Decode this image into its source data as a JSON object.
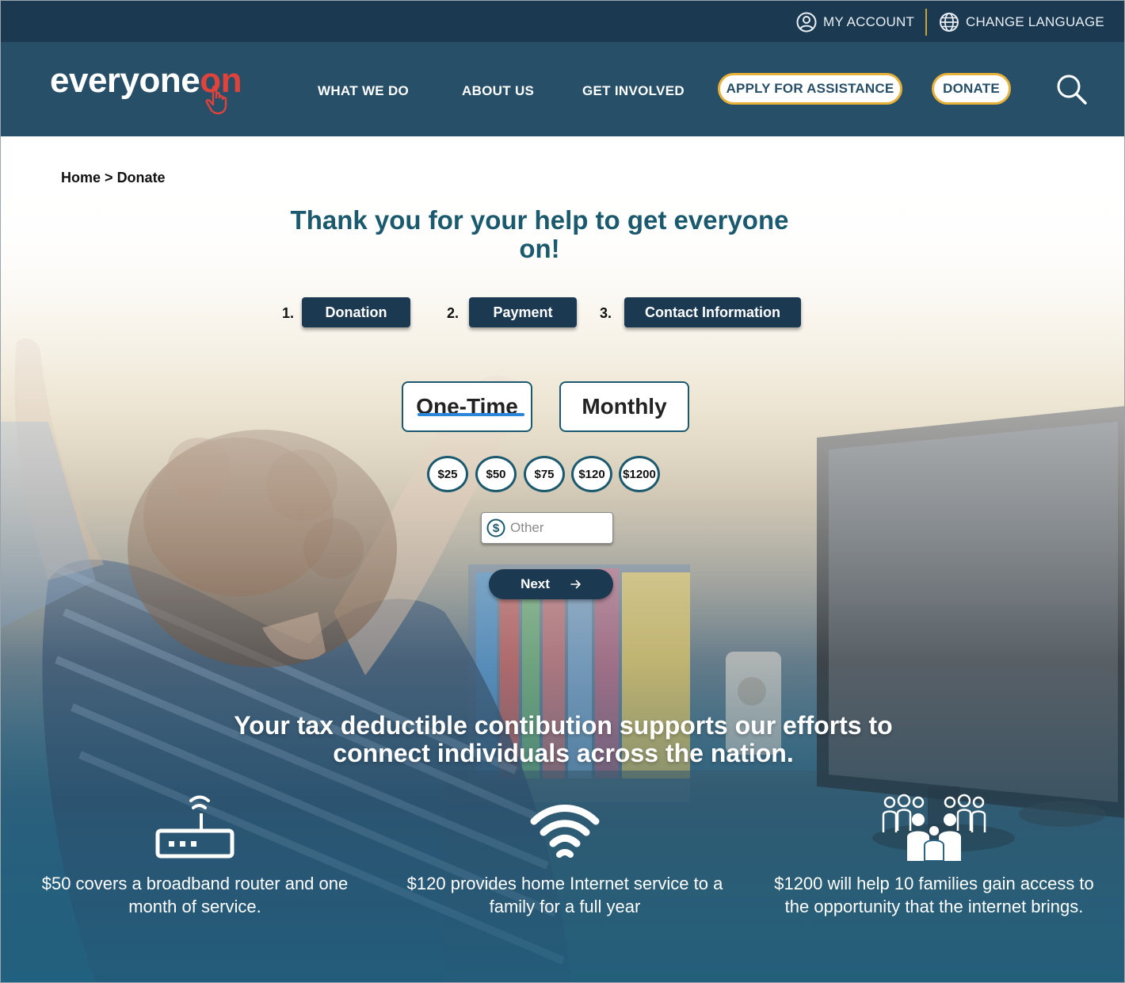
{
  "utility": {
    "account_label": "MY ACCOUNT",
    "language_label": "CHANGE LANGUAGE"
  },
  "header": {
    "logo_text_main": "everyone",
    "logo_text_accent": "on",
    "nav": {
      "what_we_do": "WHAT WE DO",
      "about_us": "ABOUT US",
      "get_involved": "GET INVOLVED"
    },
    "apply_label": "APPLY FOR ASSISTANCE",
    "donate_label": "DONATE"
  },
  "breadcrumb": {
    "home": "Home",
    "separator": ">",
    "current": "Donate"
  },
  "page_title": "Thank you for your help to get everyone on!",
  "steps": [
    {
      "number": "1.",
      "label": "Donation"
    },
    {
      "number": "2.",
      "label": "Payment"
    },
    {
      "number": "3.",
      "label": "Contact Information"
    }
  ],
  "frequency": {
    "one_time": "One-Time",
    "monthly": "Monthly",
    "selected": "One-Time"
  },
  "amounts": [
    "$25",
    "$50",
    "$75",
    "$120",
    "$1200"
  ],
  "other": {
    "placeholder": "Other"
  },
  "next_label": "Next",
  "tax_heading": "Your tax deductible contibution supports our efforts to connect individuals across the nation.",
  "impacts": [
    {
      "icon": "router-icon",
      "text": "$50 covers a broadband router and one month of service."
    },
    {
      "icon": "wifi-icon",
      "text": "$120 provides home Internet service to a family for a full year"
    },
    {
      "icon": "families-icon",
      "text": "$1200 will help 10 families gain access to the opportunity that the internet brings."
    }
  ],
  "colors": {
    "header_dark": "#1b3a52",
    "header_main": "#274f68",
    "accent_yellow": "#e8b13a",
    "logo_red": "#e0433b",
    "title_teal": "#1b5a6e",
    "tab_underline": "#2a86d8"
  }
}
